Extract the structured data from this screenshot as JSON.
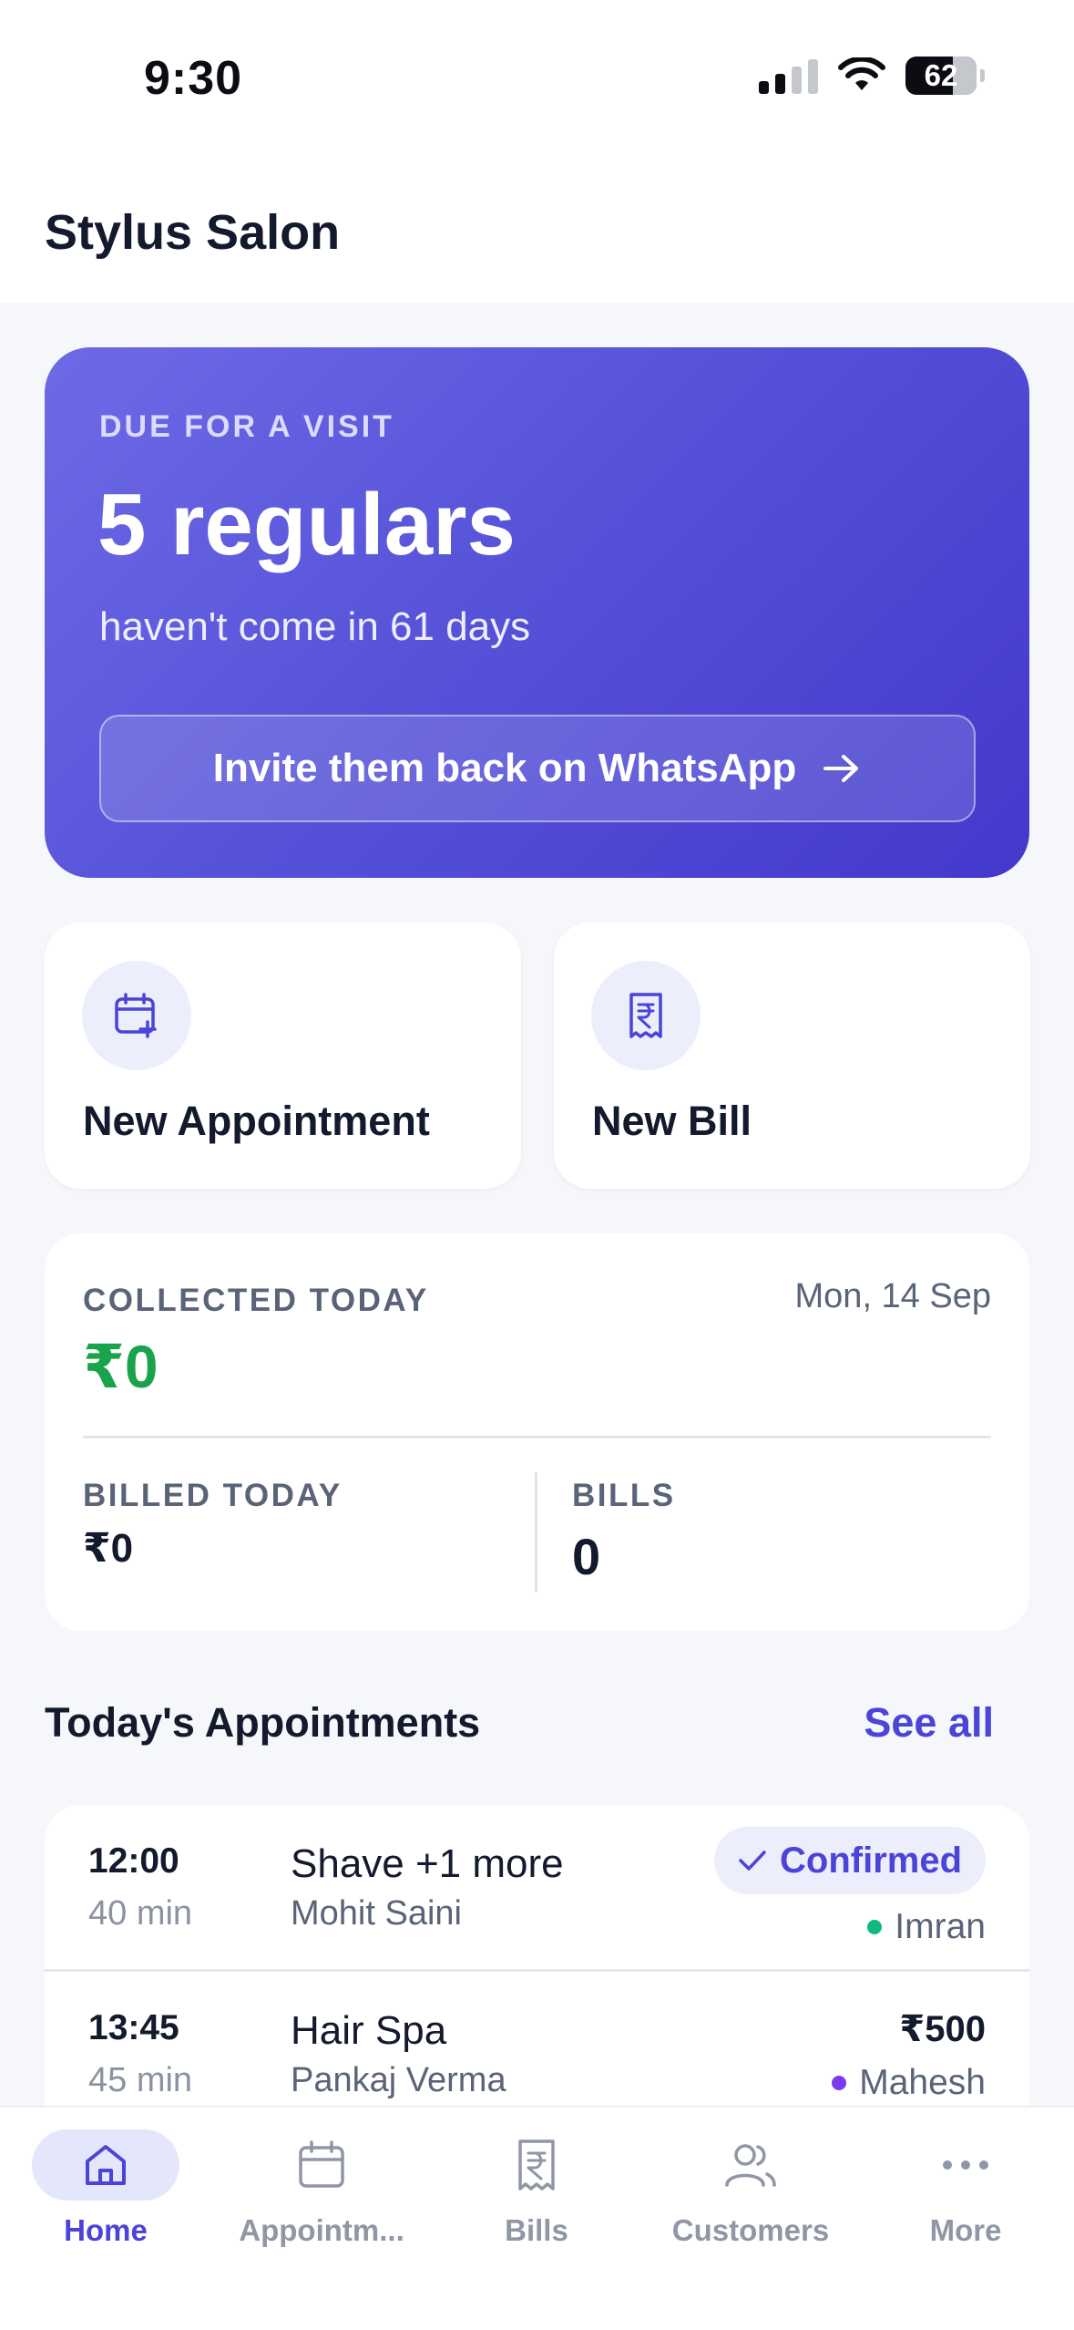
{
  "status_bar": {
    "time": "9:30",
    "battery": "62",
    "icons": [
      "signal-icon",
      "wifi-icon",
      "battery-icon"
    ]
  },
  "header": {
    "title": "Stylus Salon"
  },
  "hero": {
    "eyebrow": "DUE FOR A VISIT",
    "title": "5 regulars",
    "subtitle": "haven't come in 61 days",
    "cta_label": "Invite them back on WhatsApp",
    "gradient_colors": [
      "#6e6ae6",
      "#4338cc"
    ]
  },
  "quick_actions": [
    {
      "label": "New Appointment",
      "icon": "calendar-plus-icon"
    },
    {
      "label": "New Bill",
      "icon": "receipt-rupee-icon"
    }
  ],
  "stats": {
    "collected_label": "COLLECTED TODAY",
    "collected_value": "₹0",
    "date": "Mon, 14 Sep",
    "billed_label": "BILLED TODAY",
    "billed_value": "₹0",
    "bills_label": "BILLS",
    "bills_value": "0",
    "accent_green": "#1aa34a"
  },
  "appointments": {
    "title": "Today's Appointments",
    "see_all": "See all",
    "items": [
      {
        "time": "12:00",
        "duration": "40 min",
        "service": "Shave +1 more",
        "customer": "Mohit Saini",
        "status": "Confirmed",
        "staff": "Imran",
        "staff_color": "#10b981"
      },
      {
        "time": "13:45",
        "duration": "45 min",
        "service": "Hair Spa",
        "customer": "Pankaj Verma",
        "price": "₹500",
        "staff": "Mahesh",
        "staff_color": "#7c3aed"
      }
    ]
  },
  "tabs": [
    {
      "label": "Home",
      "icon": "home-icon",
      "active": true
    },
    {
      "label": "Appointm...",
      "icon": "calendar-icon",
      "active": false
    },
    {
      "label": "Bills",
      "icon": "receipt-icon",
      "active": false
    },
    {
      "label": "Customers",
      "icon": "users-icon",
      "active": false
    },
    {
      "label": "More",
      "icon": "more-icon",
      "active": false
    }
  ],
  "colors": {
    "accent": "#4a44d8",
    "background": "#f5f7fa",
    "text": "#141a2e",
    "muted": "#5a6478"
  }
}
